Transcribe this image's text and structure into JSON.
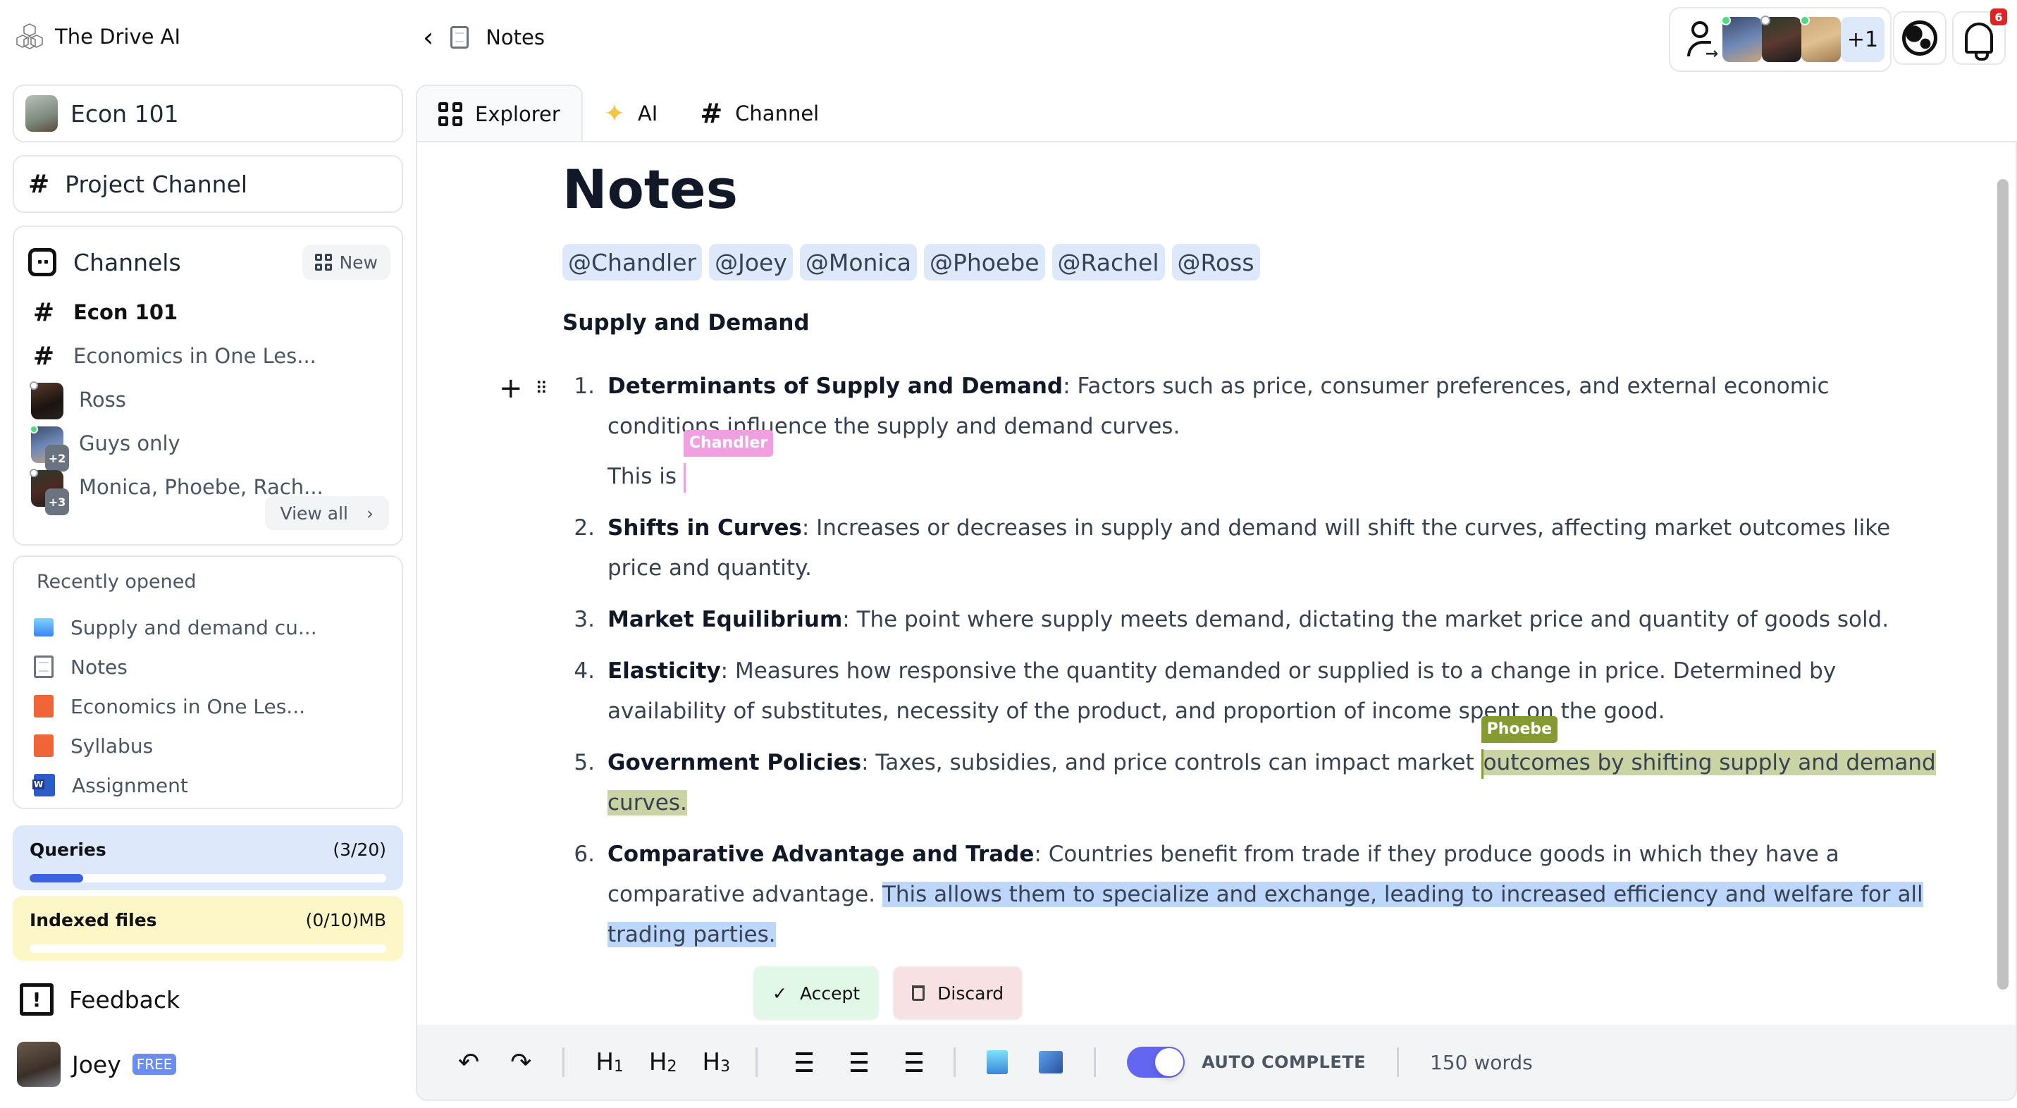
{
  "app": {
    "name": "The Drive AI"
  },
  "sidebar": {
    "workspace": {
      "label": "Econ 101"
    },
    "project_channel": {
      "label": "Project Channel"
    },
    "channels": {
      "title": "Channels",
      "new_label": "New",
      "items": [
        {
          "type": "channel",
          "label": "Econ 101",
          "active": true
        },
        {
          "type": "channel",
          "label": "Economics in One Les..."
        },
        {
          "type": "dm",
          "label": "Ross",
          "status": "offline"
        },
        {
          "type": "group",
          "label": "Guys only",
          "status": "online",
          "extra": "+2"
        },
        {
          "type": "group",
          "label": "Monica, Phoebe, Rach...",
          "status": "offline",
          "extra": "+3"
        }
      ],
      "view_all_label": "View all"
    },
    "recent": {
      "title": "Recently opened",
      "items": [
        {
          "icon": "image-file-icon",
          "label": "Supply and demand cu..."
        },
        {
          "icon": "document-icon",
          "label": "Notes"
        },
        {
          "icon": "pdf-icon",
          "label": "Economics in One Les..."
        },
        {
          "icon": "pdf-icon",
          "label": "Syllabus"
        },
        {
          "icon": "word-icon",
          "label": "Assignment"
        }
      ]
    },
    "usage": {
      "queries": {
        "label": "Queries",
        "value": "(3/20)",
        "fraction": 0.15
      },
      "indexed": {
        "label": "Indexed files",
        "value": "(0/10)MB",
        "fraction": 0
      }
    },
    "feedback_label": "Feedback",
    "user": {
      "name": "Joey",
      "plan": "FREE"
    }
  },
  "header": {
    "breadcrumb": "Notes",
    "collaborators_more": "+1",
    "notification_count": "6"
  },
  "tabs": [
    {
      "label": "Explorer",
      "active": true
    },
    {
      "label": "AI"
    },
    {
      "label": "Channel"
    }
  ],
  "document": {
    "title": "Notes",
    "mentions": [
      "@Chandler",
      "@Joey",
      "@Monica",
      "@Phoebe",
      "@Rachel",
      "@Ross"
    ],
    "section": "Supply and Demand",
    "items": [
      {
        "n": "1.",
        "term": "Determinants of Supply and Demand",
        "text": ": Factors such as price, consumer preferences, and external economic conditions influence the supply and demand curves.",
        "sub": "This is ",
        "cursor_user": "Chandler"
      },
      {
        "n": "2.",
        "term": "Shifts in Curves",
        "text": ": Increases or decreases in supply and demand will shift the curves, affecting market outcomes like price and quantity."
      },
      {
        "n": "3.",
        "term": "Market Equilibrium",
        "text": ": The point where supply meets demand, dictating the market price and quantity of goods sold."
      },
      {
        "n": "4.",
        "term": "Elasticity",
        "text": ": Measures how responsive the quantity demanded or supplied is to a change in price. Determined by availability of substitutes, necessity of the product, and proportion of income spent on the good."
      },
      {
        "n": "5.",
        "term": "Government Policies",
        "text": ": Taxes, subsidies, and price controls can impact market ",
        "highlight": "outcomes by shifting supply and demand curves.",
        "cursor_user": "Phoebe"
      },
      {
        "n": "6.",
        "term": "Comparative Advantage and Trade",
        "text": ": Countries benefit from trade if they produce goods in which they have a comparative advantage. ",
        "suggestion": "This allows them to specialize and exchange, leading to increased efficiency and welfare for all trading parties."
      }
    ],
    "accept_label": "Accept",
    "discard_label": "Discard"
  },
  "toolbar": {
    "h1": "H",
    "h2": "H",
    "h3": "H",
    "h1_sub": "1",
    "h2_sub": "2",
    "h3_sub": "3",
    "auto_complete_label": "AUTO COMPLETE",
    "auto_complete_on": true,
    "word_count": "150 words"
  },
  "colors": {
    "chandler_cursor": "#f0a0e0",
    "phoebe_cursor": "#869a32",
    "phoebe_highlight": "#c9d3a4",
    "ai_suggestion": "#bcd7fb",
    "toggle_on": "#6366f1",
    "queries_fill": "#3b62e0"
  }
}
